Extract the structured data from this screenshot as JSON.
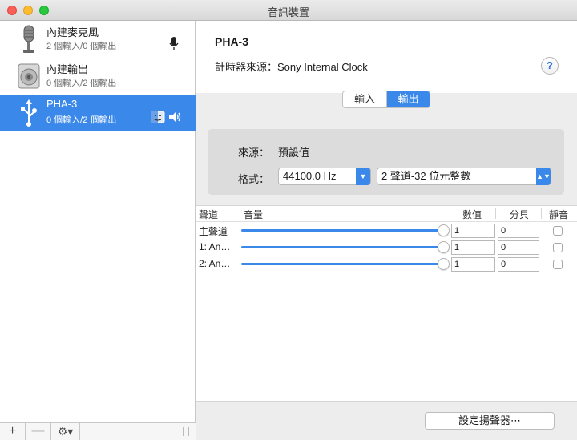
{
  "window": {
    "title": "音訊裝置"
  },
  "sidebar": {
    "devices": [
      {
        "name": "內建麥克風",
        "detail": "2 個輸入/0 個輸出",
        "icon": "microphone-icon",
        "selected": false
      },
      {
        "name": "內建輸出",
        "detail": "0 個輸入/2 個輸出",
        "icon": "speaker-icon",
        "selected": false
      },
      {
        "name": "PHA-3",
        "detail": "0 個輸入/2 個輸出",
        "icon": "usb-icon",
        "selected": true
      }
    ],
    "add_label": "+",
    "remove_label": "—",
    "gear_label": "⚙︎▾"
  },
  "detail": {
    "device_title": "PHA-3",
    "clock_label": "計時器來源：",
    "clock_value": "Sony Internal Clock",
    "help_label": "?",
    "tabs": [
      {
        "label": "輸入",
        "active": false
      },
      {
        "label": "輸出",
        "active": true
      }
    ],
    "source_label": "來源：",
    "source_value": "預設值",
    "format_label": "格式：",
    "sample_rate": "44100.0 Hz",
    "channel_format": "2 聲道-32 位元整數"
  },
  "channels": {
    "headers": {
      "channel": "聲道",
      "volume": "音量",
      "value": "數值",
      "db": "分貝",
      "mute": "靜音"
    },
    "rows": [
      {
        "name": "主聲道",
        "level": 1.0,
        "value": "1",
        "db": "0",
        "muted": false
      },
      {
        "name": "1: An…",
        "level": 1.0,
        "value": "1",
        "db": "0",
        "muted": false
      },
      {
        "name": "2: An…",
        "level": 1.0,
        "value": "1",
        "db": "0",
        "muted": false
      }
    ]
  },
  "footer": {
    "configure_speakers": "設定揚聲器⋯"
  },
  "colors": {
    "accent": "#3a88ea",
    "selected_row": "#3a88ea"
  }
}
